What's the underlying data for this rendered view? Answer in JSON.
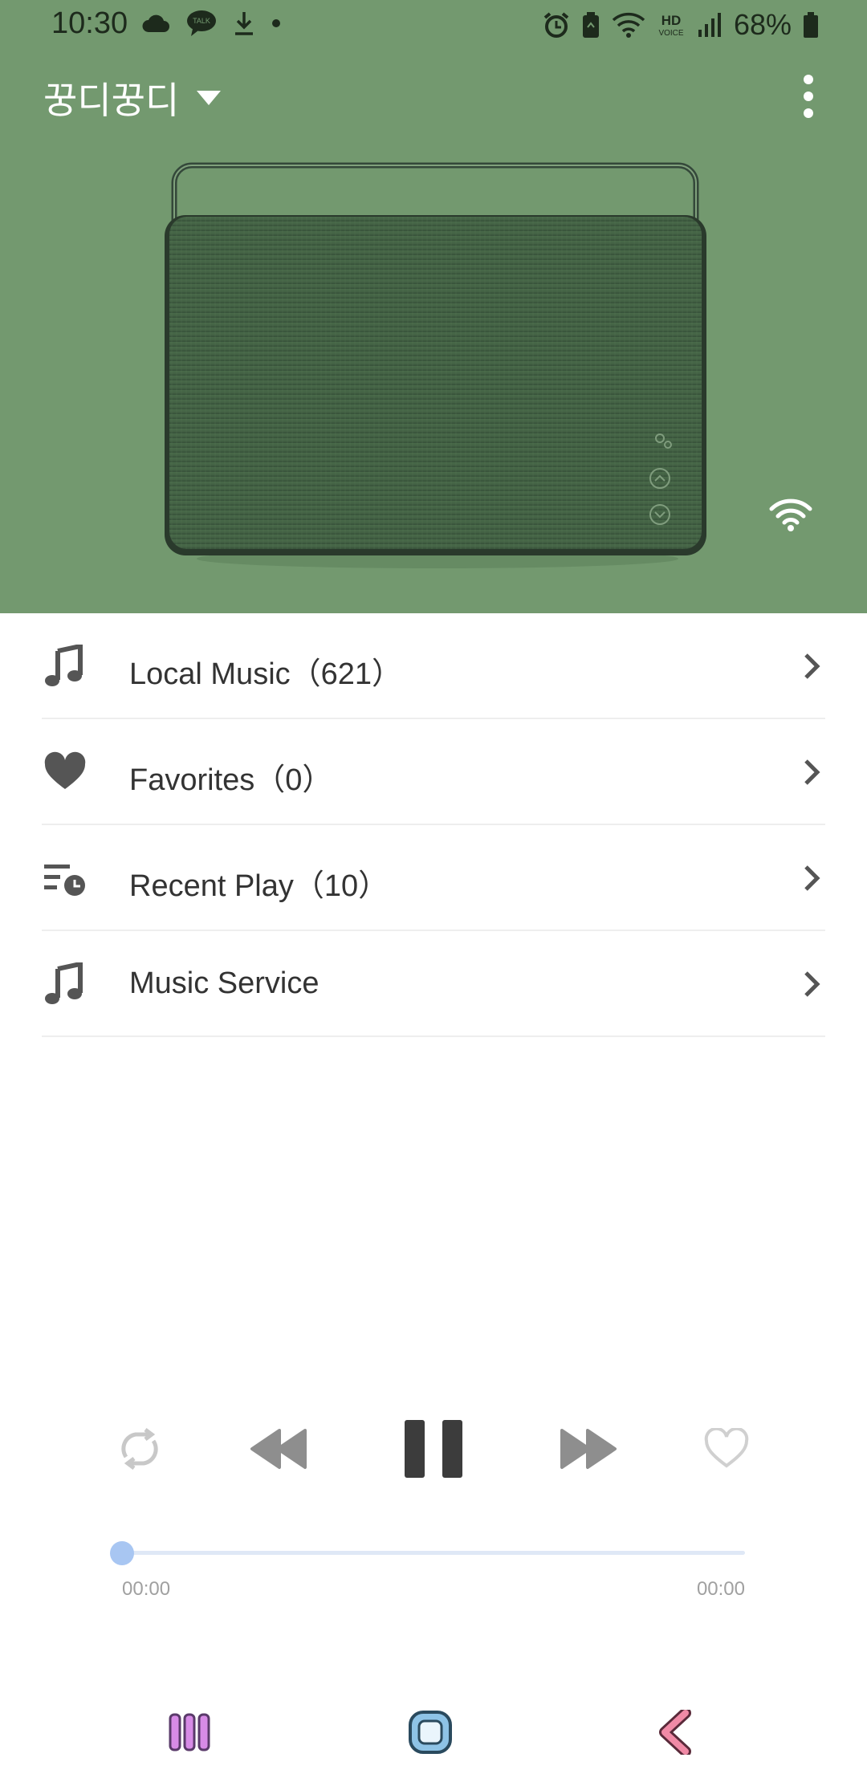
{
  "status_bar": {
    "time": "10:30",
    "battery": "68%",
    "left_icons": [
      "cloud-icon",
      "kakaotalk-icon",
      "download-icon",
      "dot-icon"
    ],
    "right_icons": [
      "alarm-icon",
      "battery-saver-icon",
      "wifi-icon",
      "hd-voice-icon",
      "signal-icon",
      "battery-icon"
    ]
  },
  "header": {
    "device_name": "꿍디꿍디",
    "dropdown_icon": "caret-down-icon",
    "menu_icon": "more-vert-icon",
    "connection_icon": "wifi-icon"
  },
  "colors": {
    "hero_bg": "#73996f",
    "speaker_body": "#3f5d40",
    "text_primary": "#333333",
    "icon_gray": "#555555",
    "progress_accent": "#a8c6f2"
  },
  "menu_items": [
    {
      "label": "Local Music（621）",
      "icon": "music-note-icon"
    },
    {
      "label": "Favorites（0）",
      "icon": "heart-icon"
    },
    {
      "label": "Recent Play（10）",
      "icon": "recent-playlist-icon"
    },
    {
      "label": "Music Service",
      "icon": "music-note-icon"
    }
  ],
  "player": {
    "repeat_icon": "repeat-icon",
    "previous_icon": "rewind-icon",
    "play_pause_icon": "pause-icon",
    "next_icon": "fast-forward-icon",
    "favorite_icon": "heart-outline-icon",
    "progress": 0.0,
    "elapsed": "00:00",
    "duration": "00:00"
  },
  "nav_bar": {
    "recents_icon": "recent-apps-icon",
    "home_icon": "home-icon",
    "back_icon": "back-icon"
  }
}
